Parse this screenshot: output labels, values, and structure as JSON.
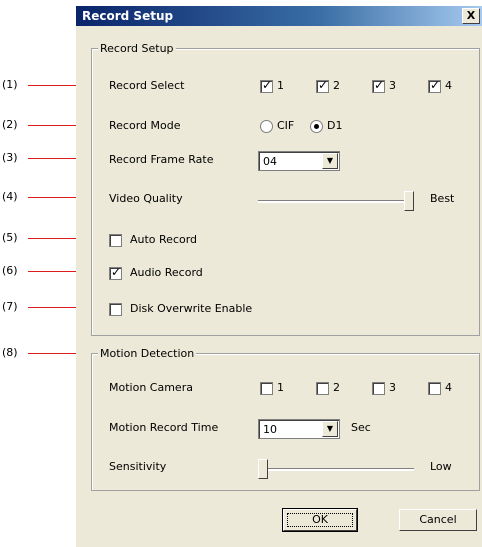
{
  "callouts": [
    "(1)",
    "(2)",
    "(3)",
    "(4)",
    "(5)",
    "(6)",
    "(7)",
    "(8)"
  ],
  "window": {
    "title": "Record Setup",
    "close": "X"
  },
  "record_setup": {
    "legend": "Record Setup",
    "record_select": {
      "label": "Record Select",
      "channels": [
        {
          "label": "1",
          "checked": true
        },
        {
          "label": "2",
          "checked": true
        },
        {
          "label": "3",
          "checked": true
        },
        {
          "label": "4",
          "checked": true
        }
      ]
    },
    "record_mode": {
      "label": "Record Mode",
      "options": [
        {
          "label": "CIF",
          "selected": false
        },
        {
          "label": "D1",
          "selected": true
        }
      ]
    },
    "frame_rate": {
      "label": "Record Frame Rate",
      "value": "04"
    },
    "video_quality": {
      "label": "Video Quality",
      "level_label": "Best",
      "level": 1.0
    },
    "auto_record": {
      "label": "Auto Record",
      "checked": false
    },
    "audio_record": {
      "label": "Audio Record",
      "checked": true
    },
    "disk_overwrite": {
      "label": "Disk Overwrite Enable",
      "checked": false
    }
  },
  "motion": {
    "legend": "Motion Detection",
    "camera": {
      "label": "Motion Camera",
      "channels": [
        {
          "label": "1",
          "checked": false
        },
        {
          "label": "2",
          "checked": false
        },
        {
          "label": "3",
          "checked": false
        },
        {
          "label": "4",
          "checked": false
        }
      ]
    },
    "record_time": {
      "label": "Motion Record Time",
      "value": "10",
      "unit": "Sec"
    },
    "sensitivity": {
      "label": "Sensitivity",
      "level_label": "Low",
      "level": 0.0
    }
  },
  "buttons": {
    "ok": "OK",
    "cancel": "Cancel"
  }
}
